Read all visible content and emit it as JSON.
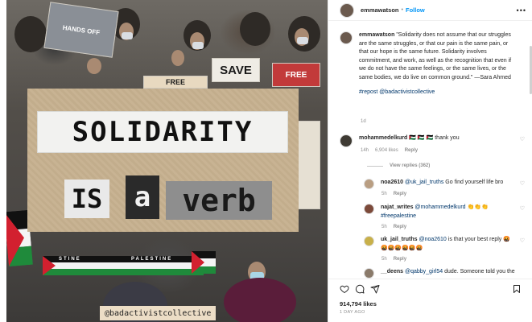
{
  "media": {
    "cutouts": {
      "word1": "SOLIDARITY",
      "word2": "IS",
      "word3": "a",
      "word4": "verb"
    },
    "signs": {
      "save": "SAVE",
      "free": "FREE",
      "palestine": "PALESTINE",
      "hands_off": "HANDS OFF",
      "stine": "STINE"
    },
    "watermark": "@badactivistcollective"
  },
  "header": {
    "username": "emmawatson",
    "separator": "•",
    "follow_label": "Follow",
    "more_label": "•••"
  },
  "caption": {
    "username": "emmawatson",
    "text": "\"Solidarity does not assume that our struggles are the same struggles, or that our pain is the same pain, or that our hope is the same future. Solidarity involves commitment, and work, as well as the recognition that even if we do not have the same feelings, or the same lives, or the same bodies, we do live on common ground.\" —Sara Ahmed",
    "repost": "#repost @badactivistcollective",
    "time": "1d"
  },
  "comments": [
    {
      "username": "mohammedelkurd",
      "text": "🇵🇸 🇵🇸 🇵🇸 thank you",
      "time": "14h",
      "likes": "6,904 likes",
      "reply_label": "Reply",
      "view_replies": "View replies (362)"
    }
  ],
  "replies": [
    {
      "username": "noa2610",
      "mention": "@uk_jail_truths",
      "text": " Go find yourself life bro",
      "time": "5h",
      "reply_label": "Reply"
    },
    {
      "username": "najat_writes",
      "mention": "@mohammedelkurd",
      "text": " 👏👏👏",
      "hashtag": "#freepalestine",
      "time": "5h",
      "reply_label": "Reply"
    },
    {
      "username": "uk_jail_truths",
      "mention": "@noa2610",
      "text": " is that your best reply 🤬",
      "emojis": "🤬🤬🤬🤬🤬🤬",
      "time": "5h",
      "reply_label": "Reply"
    },
    {
      "username": "__deens",
      "mention": "@qabby_girl54",
      "text": " dude. Someone told you the"
    }
  ],
  "actions": {
    "likes": "914,794 likes",
    "date": "1 DAY AGO"
  },
  "colors": {
    "link": "#00376b",
    "follow": "#0095f6",
    "muted": "#8e8e8e"
  }
}
